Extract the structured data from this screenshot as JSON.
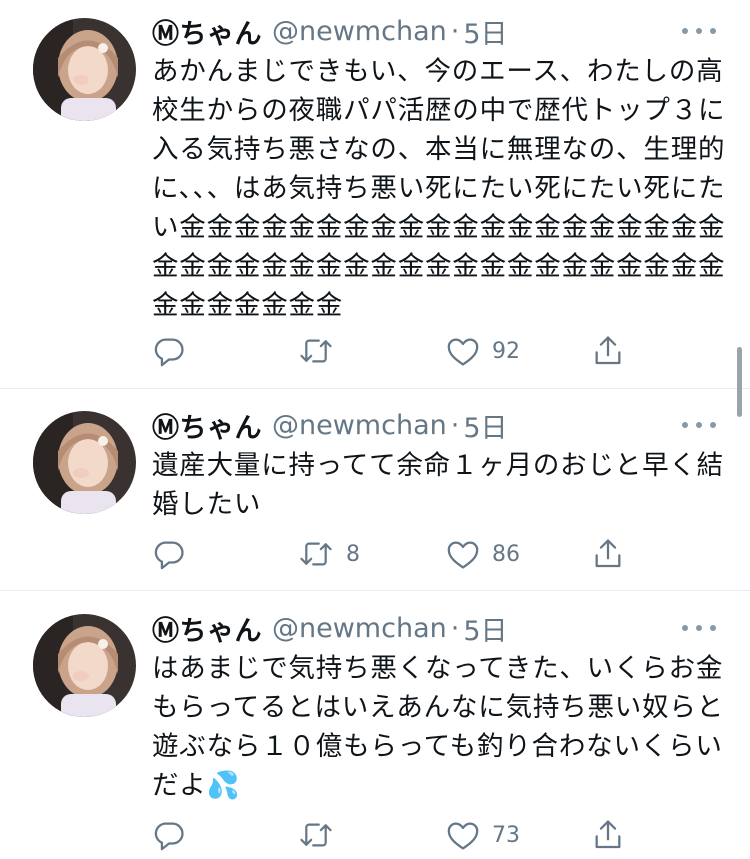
{
  "tweets": [
    {
      "name": "Ⓜちゃん",
      "handle": "@newmchan",
      "time": "5日",
      "text": "あかんまじできもい、今のエース、わたしの高校生からの夜職パパ活歴の中で歴代トップ３に入る気持ち悪さなの、本当に無理なの、生理的に、、、はあ気持ち悪い死にたい死にたい死にたい金金金金金金金金金金金金金金金金金金金金金金金金金金金金金金金金金金金金金金金金金金金金金金金金",
      "reply_count": "",
      "retweet_count": "",
      "like_count": "92"
    },
    {
      "name": "Ⓜちゃん",
      "handle": "@newmchan",
      "time": "5日",
      "text": "遺産大量に持ってて余命１ヶ月のおじと早く結婚したい",
      "reply_count": "",
      "retweet_count": "8",
      "like_count": "86"
    },
    {
      "name": "Ⓜちゃん",
      "handle": "@newmchan",
      "time": "5日",
      "text": "はあまじで気持ち悪くなってきた、いくらお金もらってるとはいえあんなに気持ち悪い奴らと遊ぶなら１０億もらっても釣り合わないくらいだよ💦",
      "reply_count": "",
      "retweet_count": "",
      "like_count": "73"
    }
  ],
  "colors": {
    "text": "#0f1419",
    "secondary": "#657786",
    "divider": "#e6ecf0",
    "icon": "#657786"
  },
  "icons": [
    "reply-icon",
    "retweet-icon",
    "like-icon",
    "share-icon",
    "more-icon"
  ]
}
